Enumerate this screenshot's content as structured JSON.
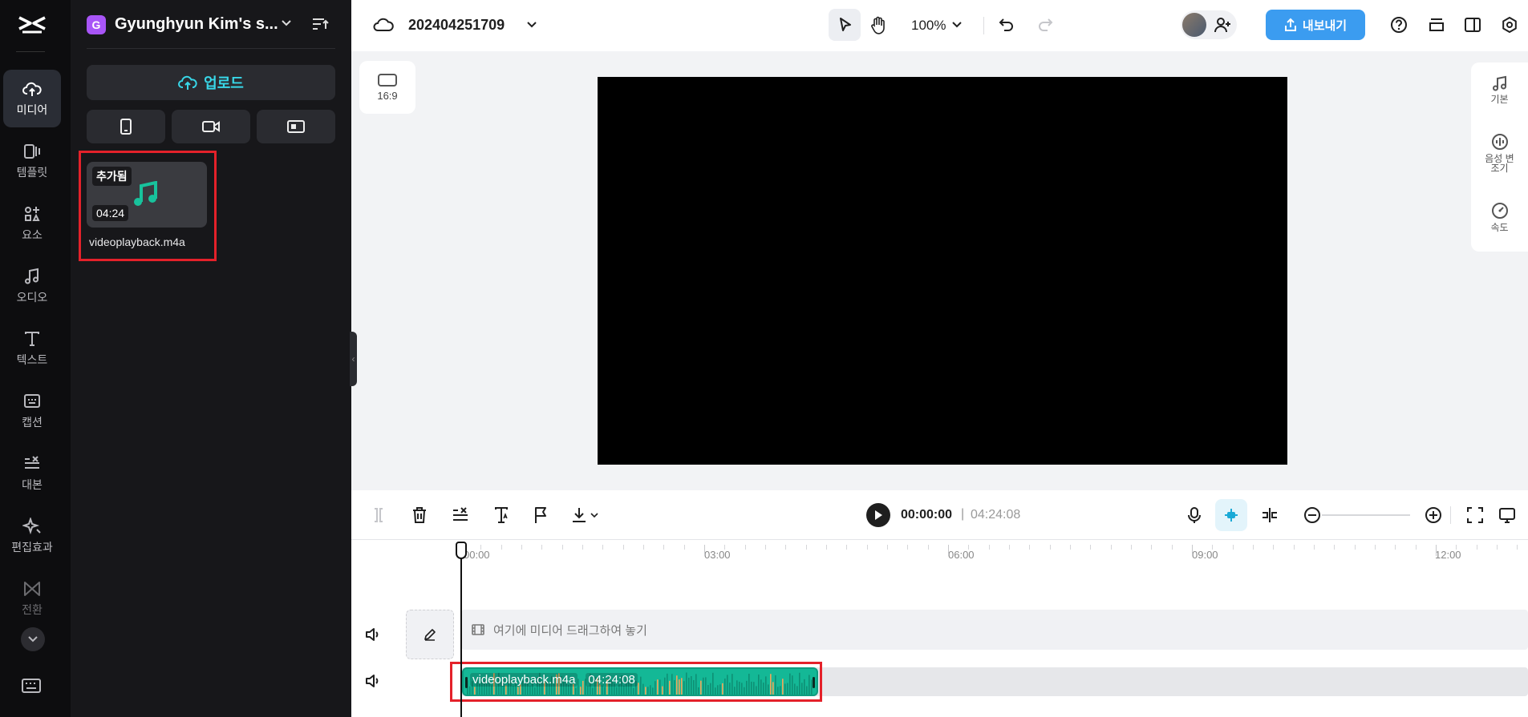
{
  "rail": {
    "items": [
      {
        "label": "미디어",
        "icon": "upload-cloud-icon",
        "active": true
      },
      {
        "label": "템플릿",
        "icon": "template-icon"
      },
      {
        "label": "요소",
        "icon": "elements-icon"
      },
      {
        "label": "오디오",
        "icon": "music-note-icon"
      },
      {
        "label": "텍스트",
        "icon": "text-t-icon"
      },
      {
        "label": "캡션",
        "icon": "caption-icon"
      },
      {
        "label": "대본",
        "icon": "script-icon"
      },
      {
        "label": "편집효과",
        "icon": "effects-sparkle-icon"
      },
      {
        "label": "전환",
        "icon": "transition-icon"
      }
    ]
  },
  "panel": {
    "workspace_initial": "G",
    "workspace_name": "Gyunghyun Kim's s...",
    "upload_label": "업로드",
    "media": {
      "status_tag": "추가됨",
      "duration": "04:24",
      "filename": "videoplayback.m4a"
    }
  },
  "topbar": {
    "project_name": "202404251709",
    "zoom": "100%",
    "export_label": "내보내기"
  },
  "canvas": {
    "ratio_label": "16:9"
  },
  "right_panel": {
    "items": [
      {
        "label": "기본",
        "icon": "music-note-icon"
      },
      {
        "label": "음성 변조기",
        "icon": "voice-changer-icon"
      },
      {
        "label": "속도",
        "icon": "speed-gauge-icon"
      }
    ]
  },
  "playback": {
    "current_time": "00:00:00",
    "separator": "|",
    "total_time": "04:24:08"
  },
  "timeline": {
    "ruler": [
      "00:00",
      "03:00",
      "06:00",
      "09:00",
      "12:00"
    ],
    "drop_placeholder": "여기에 미디어 드래그하여 놓기",
    "clip": {
      "name": "videoplayback.m4a",
      "duration": "04:24:08"
    }
  },
  "colors": {
    "accent": "#3b9cf0",
    "cyan": "#38d7e8",
    "clip": "#14b896",
    "highlight": "#e4212a"
  }
}
